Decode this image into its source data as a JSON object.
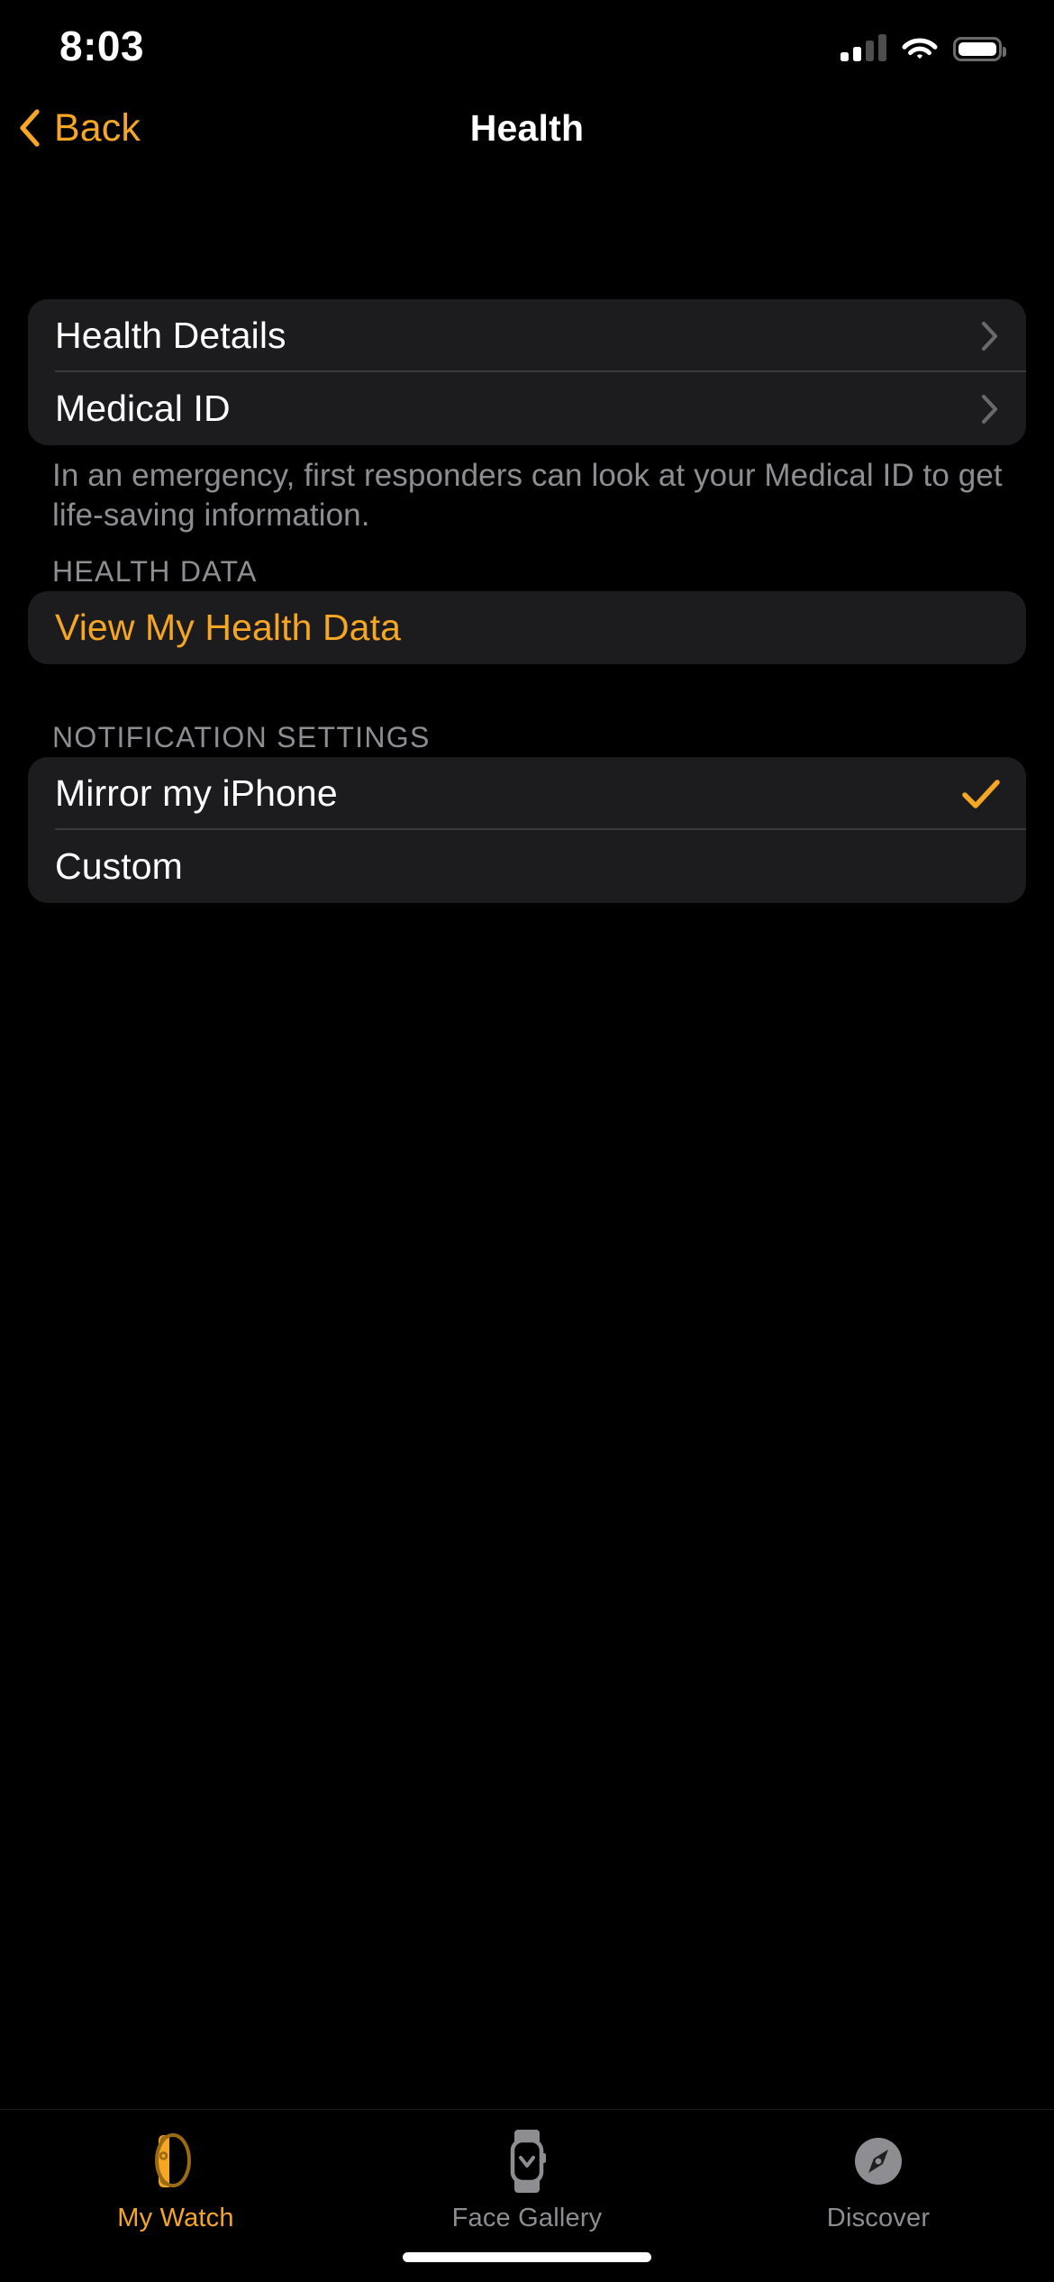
{
  "status_bar": {
    "time": "8:03",
    "cellular_icon": "cellular-signal-icon",
    "cellular_bars_filled": 2,
    "cellular_bars_total": 4,
    "wifi_icon": "wifi-icon",
    "battery_icon": "battery-icon",
    "battery_level_percent": 100
  },
  "nav": {
    "back_label": "Back",
    "back_icon": "chevron-left-icon",
    "title": "Health"
  },
  "groups": {
    "details": {
      "rows": [
        {
          "label": "Health Details",
          "accessory": "chevron-right-icon"
        },
        {
          "label": "Medical ID",
          "accessory": "chevron-right-icon"
        }
      ],
      "footer": "In an emergency, first responders can look at your Medical ID to get life-saving information."
    },
    "health_data": {
      "header": "HEALTH DATA",
      "rows": [
        {
          "label": "View My Health Data",
          "accessory": "none"
        }
      ]
    },
    "notification_settings": {
      "header": "NOTIFICATION SETTINGS",
      "rows": [
        {
          "label": "Mirror my iPhone",
          "accessory": "checkmark-icon",
          "selected": true
        },
        {
          "label": "Custom",
          "accessory": "none",
          "selected": false
        }
      ]
    }
  },
  "tab_bar": {
    "tabs": [
      {
        "label": "My Watch",
        "icon": "apple-watch-side-icon",
        "active": true
      },
      {
        "label": "Face Gallery",
        "icon": "watch-face-icon",
        "active": false
      },
      {
        "label": "Discover",
        "icon": "compass-icon",
        "active": false
      }
    ]
  },
  "colors": {
    "accent": "#F5A623",
    "background": "#000000",
    "card": "#1C1C1E",
    "separator": "#3A3A3C",
    "secondary_text": "#8D8D92"
  }
}
